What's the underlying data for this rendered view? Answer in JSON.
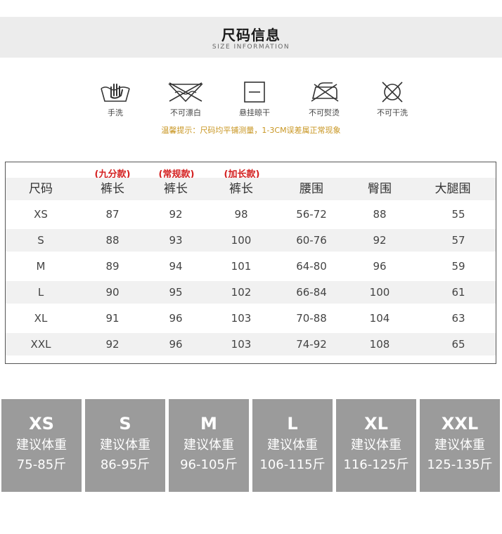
{
  "header": {
    "title": "尺码信息",
    "subtitle": "SIZE INFORMATION"
  },
  "care": [
    {
      "label": "手洗",
      "icon": "hand-wash-icon"
    },
    {
      "label": "不可漂白",
      "icon": "no-bleach-icon"
    },
    {
      "label": "悬挂晾干",
      "icon": "hang-dry-icon"
    },
    {
      "label": "不可熨烫",
      "icon": "no-iron-icon"
    },
    {
      "label": "不可干洗",
      "icon": "no-dry-clean-icon"
    }
  ],
  "tip": "温馨提示：尺码均平铺测量，1-3CM误差属正常现象",
  "table": {
    "tags": [
      "(九分款)",
      "(常规款)",
      "(加长款)"
    ],
    "headers": [
      "尺码",
      "裤长",
      "裤长",
      "裤长",
      "腰围",
      "臀围",
      "大腿围"
    ],
    "rows": [
      [
        "XS",
        "87",
        "92",
        "98",
        "56-72",
        "88",
        "55"
      ],
      [
        "S",
        "88",
        "93",
        "100",
        "60-76",
        "92",
        "57"
      ],
      [
        "M",
        "89",
        "94",
        "101",
        "64-80",
        "96",
        "59"
      ],
      [
        "L",
        "90",
        "95",
        "102",
        "66-84",
        "100",
        "61"
      ],
      [
        "XL",
        "91",
        "96",
        "103",
        "70-88",
        "104",
        "63"
      ],
      [
        "XXL",
        "92",
        "96",
        "103",
        "74-92",
        "108",
        "65"
      ]
    ]
  },
  "cards": [
    {
      "size": "XS",
      "label": "建议体重",
      "weight": "75-85斤"
    },
    {
      "size": "S",
      "label": "建议体重",
      "weight": "86-95斤"
    },
    {
      "size": "M",
      "label": "建议体重",
      "weight": "96-105斤"
    },
    {
      "size": "L",
      "label": "建议体重",
      "weight": "106-115斤"
    },
    {
      "size": "XL",
      "label": "建议体重",
      "weight": "116-125斤"
    },
    {
      "size": "XXL",
      "label": "建议体重",
      "weight": "125-135斤"
    }
  ],
  "colors": {
    "tip": "#c89520",
    "tag": "#d42020",
    "card": "#9b9b9b",
    "header_bg": "#ececec"
  }
}
